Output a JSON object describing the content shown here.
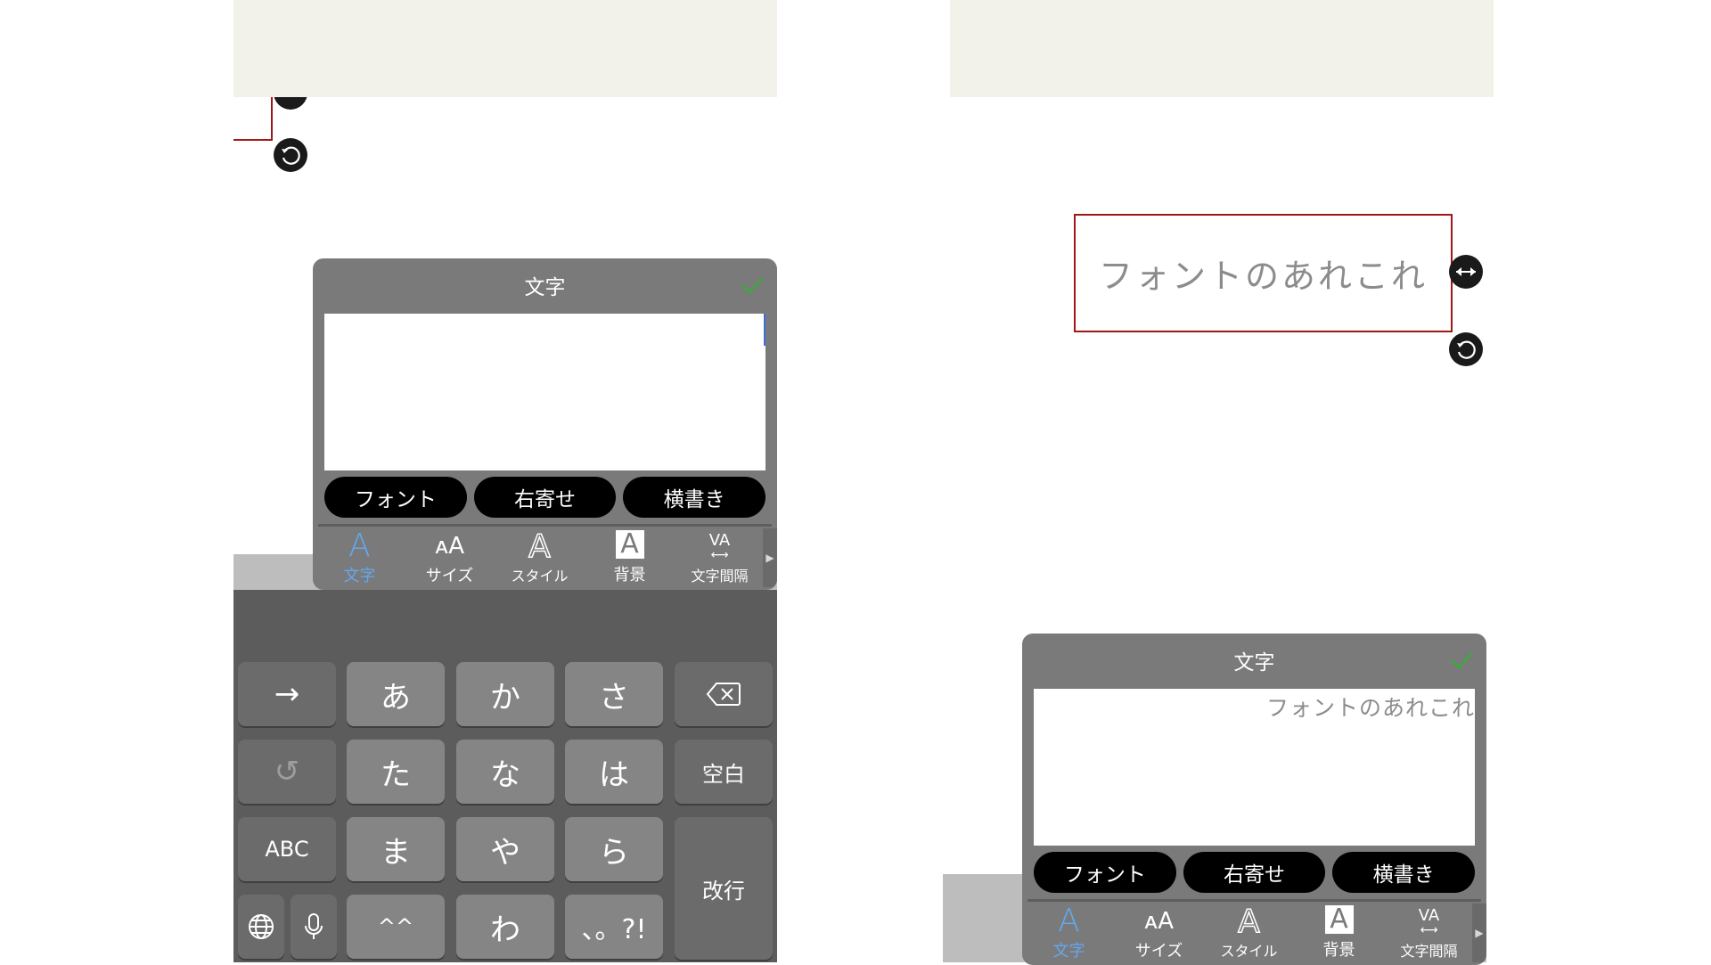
{
  "left": {
    "panel": {
      "title": "文字",
      "text_value": "",
      "buttons": [
        "フォント",
        "右寄せ",
        "横書き"
      ],
      "tabs": [
        {
          "glyph": "A",
          "label": "文字",
          "icon": "text-icon",
          "active": true
        },
        {
          "glyph": "ᴀA",
          "label": "サイズ",
          "icon": "size-icon",
          "active": false
        },
        {
          "glyph": "A",
          "label": "スタイル",
          "icon": "style-icon",
          "active": false
        },
        {
          "glyph": "A",
          "label": "背景",
          "icon": "background-icon",
          "active": false
        },
        {
          "glyph": "VA",
          "label": "文字間隔",
          "icon": "letter-spacing-icon",
          "active": false
        }
      ]
    },
    "keyboard": {
      "rows": [
        [
          "→",
          "あ",
          "か",
          "さ",
          "⌫"
        ],
        [
          "↺",
          "た",
          "な",
          "は",
          "空白"
        ],
        [
          "ABC",
          "ま",
          "や",
          "ら",
          "改行"
        ],
        [
          "🌐",
          "🎤",
          "^^",
          "わ",
          "、。?!"
        ]
      ]
    }
  },
  "right": {
    "canvas_text": "フォントのあれこれ",
    "panel": {
      "title": "文字",
      "text_value": "フォントのあれこれ",
      "buttons": [
        "フォント",
        "右寄せ",
        "横書き"
      ],
      "tabs": [
        {
          "glyph": "A",
          "label": "文字",
          "icon": "text-icon",
          "active": true
        },
        {
          "glyph": "ᴀA",
          "label": "サイズ",
          "icon": "size-icon",
          "active": false
        },
        {
          "glyph": "A",
          "label": "スタイル",
          "icon": "style-icon",
          "active": false
        },
        {
          "glyph": "A",
          "label": "背景",
          "icon": "background-icon",
          "active": false
        },
        {
          "glyph": "VA",
          "label": "文字間隔",
          "icon": "letter-spacing-icon",
          "active": false
        }
      ]
    }
  },
  "colors": {
    "accent_blue": "#62a8f0",
    "check_green": "#3fa83f",
    "selection_red": "#a01818",
    "panel_gray": "#7a7a7a"
  }
}
